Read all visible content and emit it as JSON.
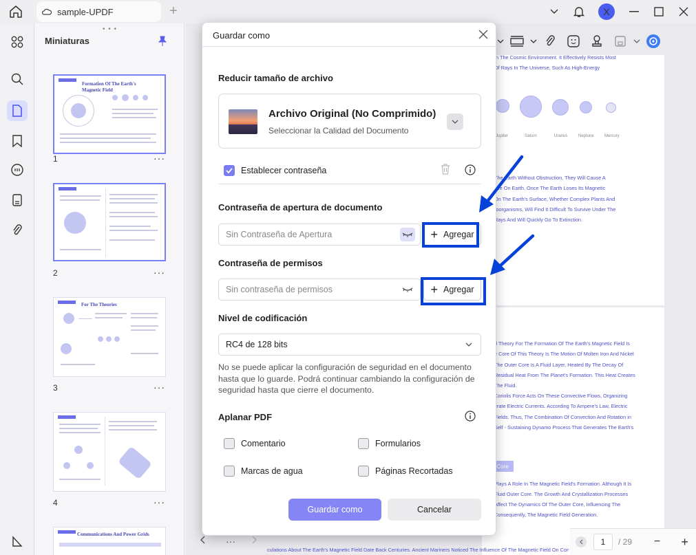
{
  "titlebar": {
    "tab_label": "sample-UPDF",
    "avatar_letter": "X"
  },
  "thumbnails": {
    "title": "Miniaturas",
    "pages": [
      {
        "number": "1",
        "heading": "Formation Of The Earth's Magnetic Field"
      },
      {
        "number": "2",
        "heading": ""
      },
      {
        "number": "3",
        "heading": "For The Theories"
      },
      {
        "number": "4",
        "heading": ""
      },
      {
        "number": "",
        "heading": "Communications And Power Grids"
      }
    ],
    "more_glyph": "···"
  },
  "document": {
    "page1_lines": [
      "In The Cosmic Environment. It Effectively Resists Most",
      "Of Rays In The Universe, Such As High-Energy",
      "The Earth Without Obstruction, They Will Cause A",
      "Life On Earth. Once The Earth Loses Its Magnetic",
      "On The Earth's Surface, Whether Complex Plants And",
      "roorganisms, Will Find It Difficult To Survive Under The",
      "Rays And Will Quickly Go To Extinction."
    ],
    "planet_labels": [
      "Jupiter",
      "Saturn",
      "Uranus",
      "Neptune",
      "Mercury"
    ],
    "page2_lines": [
      "d Theory For The Formation Of The Earth's Magnetic Field Is",
      "e Core Of This Theory Is The Motion Of Molten Iron And Nickel",
      "The Outer Core Is A Fluid Layer, Heated By The Decay Of",
      "Residual Heat From The Planet's Formation. This Heat Creates",
      "The Fluid.",
      "Coriolis Force Acts On These Convective Flows, Organizing",
      "erate Electric Currents. According To Ampere's Law, Electric",
      "Fields. Thus, The Combination Of Convection And Rotation in",
      "Self - Sustaining Dynamo Process That Generates The Earth's"
    ],
    "core_tag": "Core",
    "page2_lower_lines": [
      "Plays A Role In The Magnetic Field's Formation. Although It Is",
      "Fluid Outer Core. The Growth And Crystallization Processes",
      "Affect The Dynamics Of The Outer Core, Influencing The",
      "Consequently, The Magnetic Field Generation."
    ],
    "bottom_line": "culations About The Earth's Magnetic Field Date Back Centuries. Ancient Mariners Noticed The Influence Of The Magnetic Field On Compa"
  },
  "pagination": {
    "current": "1",
    "total": "/ 29"
  },
  "dialog": {
    "title": "Guardar como",
    "reduce_heading": "Reducir tamaño de archivo",
    "quality_title": "Archivo Original (No Comprimido)",
    "quality_subtitle": "Seleccionar la Calidad del Documento",
    "set_password_label": "Establecer contraseña",
    "open_pw_heading": "Contraseña de apertura de documento",
    "open_pw_placeholder": "Sin Contraseña de Apertura",
    "perm_pw_heading": "Contraseña de permisos",
    "perm_pw_placeholder": "Sin contraseña de permisos",
    "add_label": "Agregar",
    "encryption_heading": "Nivel de codificación",
    "encryption_value": "RC4 de 128 bits",
    "info_text": "No se puede aplicar la configuración de seguridad en el documento hasta que lo guarde. Podrá continuar cambiando la configuración de seguridad hasta que cierre el documento.",
    "flatten_heading": "Aplanar PDF",
    "flatten_options": {
      "comment": "Comentario",
      "forms": "Formularios",
      "watermarks": "Marcas de agua",
      "cropped": "Páginas Recortadas"
    },
    "save_button": "Guardar como",
    "cancel_button": "Cancelar"
  },
  "colors": {
    "accent": "#7a7cf0",
    "highlight": "#0642d8",
    "primary_button": "#8585f5"
  }
}
